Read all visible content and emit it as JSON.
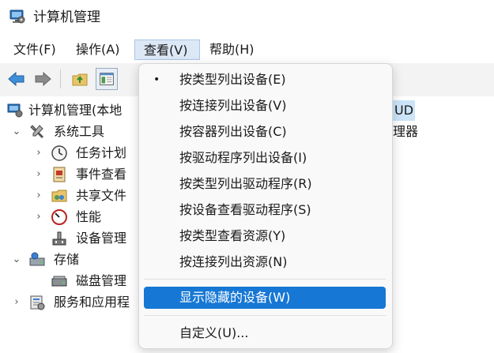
{
  "window": {
    "title": "计算机管理"
  },
  "menubar": {
    "items": [
      {
        "label": "文件(F)"
      },
      {
        "label": "操作(A)"
      },
      {
        "label": "查看(V)"
      },
      {
        "label": "帮助(H)"
      }
    ]
  },
  "tree": {
    "root": "计算机管理(本地",
    "system_tools": "系统工具",
    "task_scheduler": "任务计划",
    "event_viewer": "事件查看",
    "shared_folders": "共享文件",
    "performance": "性能",
    "device_manager": "设备管理",
    "storage": "存储",
    "disk_management": "磁盘管理",
    "services": "服务和应用程"
  },
  "right_peek": {
    "selected_suffix": "UD",
    "manager_suffix": "理器"
  },
  "view_menu": {
    "items": [
      {
        "label": "按类型列出设备(E)",
        "checked": true
      },
      {
        "label": "按连接列出设备(V)"
      },
      {
        "label": "按容器列出设备(C)"
      },
      {
        "label": "按驱动程序列出设备(I)"
      },
      {
        "label": "按类型列出驱动程序(R)"
      },
      {
        "label": "按设备查看驱动程序(S)"
      },
      {
        "label": "按类型查看资源(Y)"
      },
      {
        "label": "按连接列出资源(N)"
      },
      {
        "label": "显示隐藏的设备(W)",
        "highlighted": true
      },
      {
        "label": "自定义(U)..."
      }
    ],
    "bullet": "•"
  },
  "colors": {
    "highlight": "#1677d4",
    "selection": "#cce4f7",
    "menu_active": "#dce8f6"
  }
}
